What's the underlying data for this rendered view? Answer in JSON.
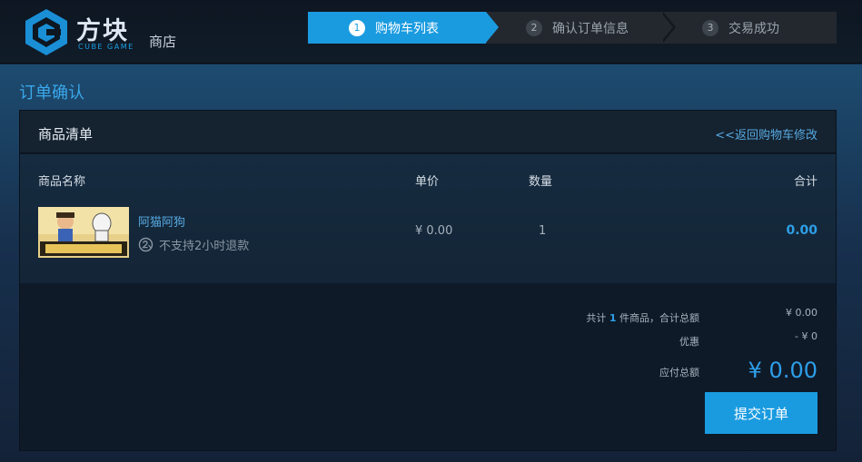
{
  "header": {
    "logo_cn": "方块",
    "logo_en": "CUBE GAME",
    "store_label": "商店",
    "steps": [
      {
        "num": "1",
        "label": "购物车列表"
      },
      {
        "num": "2",
        "label": "确认订单信息"
      },
      {
        "num": "3",
        "label": "交易成功"
      }
    ],
    "active_step": 1
  },
  "page_title": "订单确认",
  "panel": {
    "title": "商品清单",
    "back_link": "<<返回购物车修改",
    "columns": {
      "name": "商品名称",
      "price": "单价",
      "qty": "数量",
      "total": "合计"
    },
    "items": [
      {
        "name": "阿猫阿狗",
        "refund_note": "不支持2小时退款",
        "price": "¥ 0.00",
        "qty": "1",
        "total": "0.00"
      }
    ]
  },
  "summary": {
    "count_prefix": "共计 ",
    "count": "1",
    "count_suffix": " 件商品，合计总额",
    "subtotal": "¥ 0.00",
    "discount_label": "优惠",
    "discount": "- ¥ 0",
    "due_label": "应付总额",
    "due": "¥ 0.00",
    "submit_label": "提交订单"
  },
  "colors": {
    "accent": "#1a9be0",
    "link": "#56a9e0",
    "header_bg": "#0d1621",
    "panel_bg": "#0f1a29"
  },
  "icons": {
    "logo": "cube-logo-icon",
    "refund": "no-refund-2h-icon"
  }
}
